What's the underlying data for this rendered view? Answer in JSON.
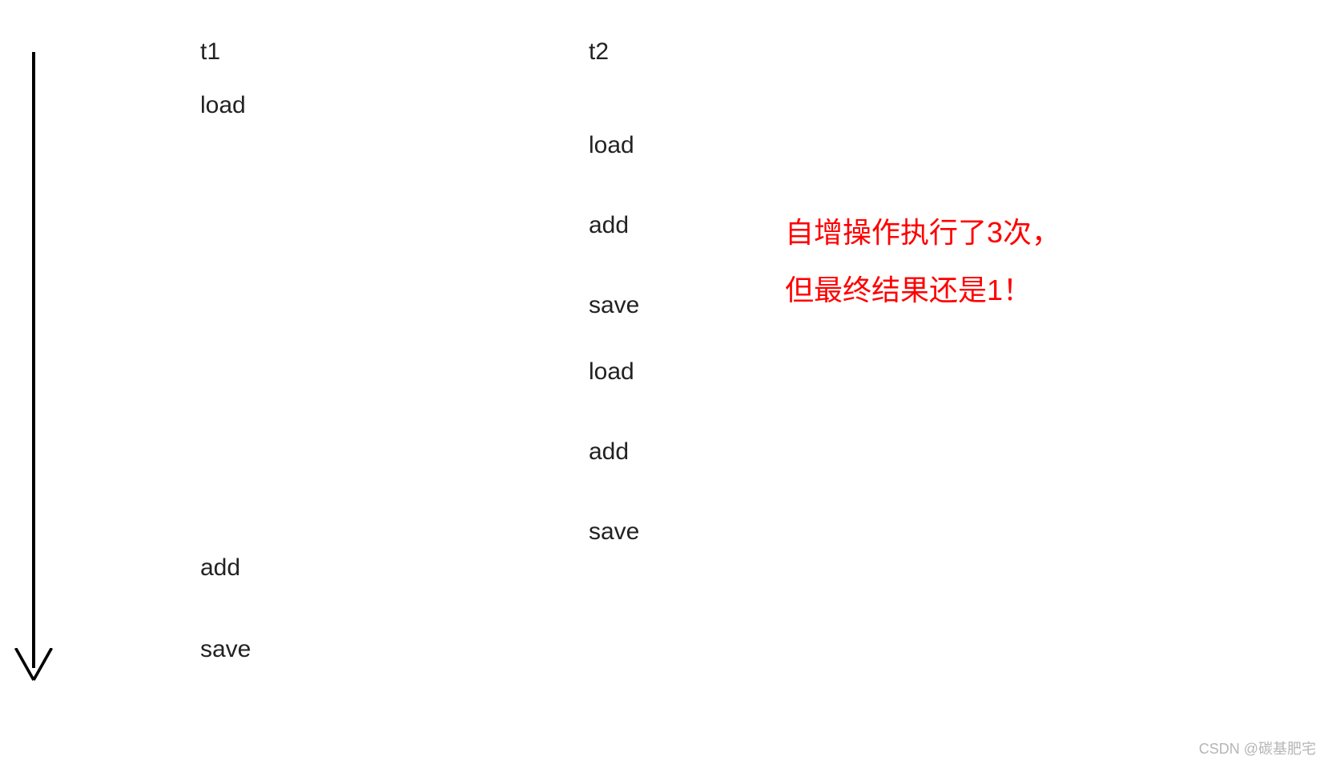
{
  "columns": {
    "t1_header": "t1",
    "t2_header": "t2"
  },
  "t1_ops": {
    "op0": "load",
    "op1": "add",
    "op2": "save"
  },
  "t2_ops": {
    "op0": "load",
    "op1": "add",
    "op2": "save",
    "op3": "load",
    "op4": "add",
    "op5": "save"
  },
  "annotation": {
    "line1": "自增操作执行了3次，",
    "line2": "但最终结果还是1！"
  },
  "watermark": "CSDN @碳基肥宅"
}
